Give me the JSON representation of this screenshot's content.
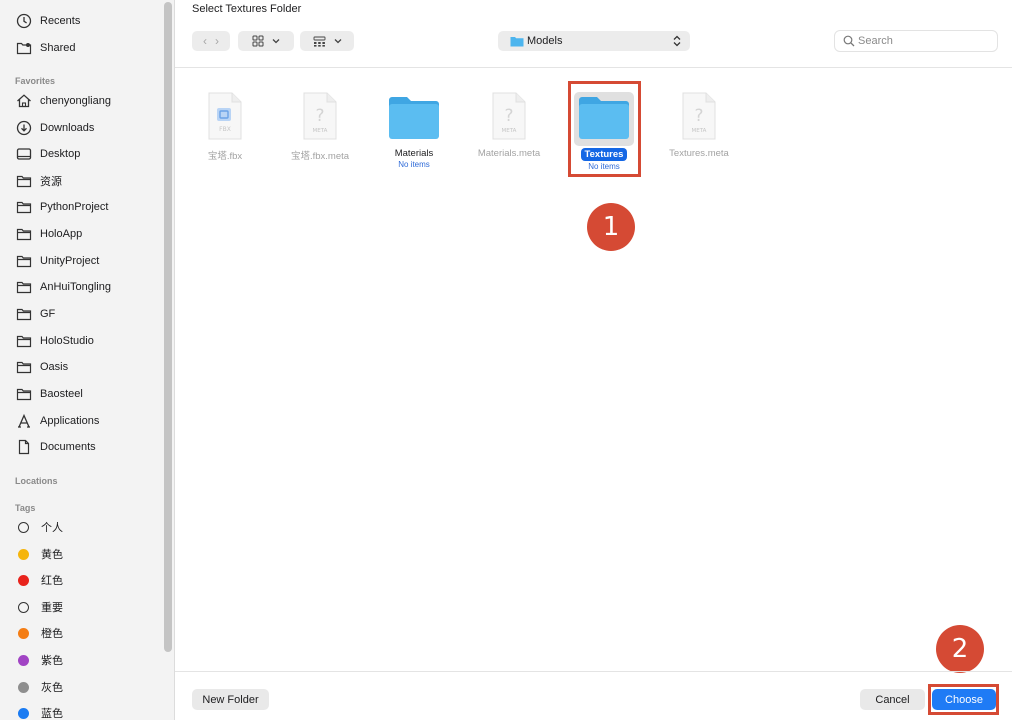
{
  "dialog": {
    "title": "Select Textures Folder"
  },
  "sidebar": {
    "top_items": [
      {
        "label": "Recents",
        "icon": "clock-icon"
      },
      {
        "label": "Shared",
        "icon": "shared-folder-icon"
      }
    ],
    "favorites_heading": "Favorites",
    "favorites": [
      {
        "label": "chenyongliang",
        "icon": "home-icon"
      },
      {
        "label": "Downloads",
        "icon": "download-icon"
      },
      {
        "label": "Desktop",
        "icon": "desktop-icon"
      },
      {
        "label": "资源",
        "icon": "folder-icon"
      },
      {
        "label": "PythonProject",
        "icon": "folder-icon"
      },
      {
        "label": "HoloApp",
        "icon": "folder-icon"
      },
      {
        "label": "UnityProject",
        "icon": "folder-icon"
      },
      {
        "label": "AnHuiTongling",
        "icon": "folder-icon"
      },
      {
        "label": "GF",
        "icon": "folder-icon"
      },
      {
        "label": "HoloStudio",
        "icon": "folder-icon"
      },
      {
        "label": "Oasis",
        "icon": "folder-icon"
      },
      {
        "label": "Baosteel",
        "icon": "folder-icon"
      },
      {
        "label": "Applications",
        "icon": "applications-icon"
      },
      {
        "label": "Documents",
        "icon": "document-icon"
      }
    ],
    "locations_heading": "Locations",
    "tags_heading": "Tags",
    "tags": [
      {
        "label": "个人",
        "color": "none"
      },
      {
        "label": "黄色",
        "color": "#f5b50c"
      },
      {
        "label": "红色",
        "color": "#e8231c"
      },
      {
        "label": "重要",
        "color": "none"
      },
      {
        "label": "橙色",
        "color": "#f47d14"
      },
      {
        "label": "紫色",
        "color": "#a144c4"
      },
      {
        "label": "灰色",
        "color": "#8e8e8e"
      },
      {
        "label": "蓝色",
        "color": "#1a7bf2"
      }
    ]
  },
  "toolbar": {
    "path": "Models",
    "search_placeholder": "Search"
  },
  "files": [
    {
      "name": "宝塔.fbx",
      "kind": "fbx",
      "sub": "",
      "thumb_label": "FBX"
    },
    {
      "name": "宝塔.fbx.meta",
      "kind": "meta",
      "sub": "",
      "thumb_label": "META"
    },
    {
      "name": "Materials",
      "kind": "folder",
      "sub": "No items",
      "thumb_label": ""
    },
    {
      "name": "Materials.meta",
      "kind": "meta",
      "sub": "",
      "thumb_label": "META"
    },
    {
      "name": "Textures",
      "kind": "folder",
      "sub": "No items",
      "thumb_label": "",
      "selected": true
    },
    {
      "name": "Textures.meta",
      "kind": "meta",
      "sub": "",
      "thumb_label": "META"
    }
  ],
  "annotations": {
    "step1": "1",
    "step2": "2"
  },
  "footer": {
    "new_folder": "New Folder",
    "cancel": "Cancel",
    "choose": "Choose"
  },
  "colors": {
    "accent": "#1f7bf5",
    "annotation": "#d54a34",
    "folder": "#4db5ee"
  }
}
